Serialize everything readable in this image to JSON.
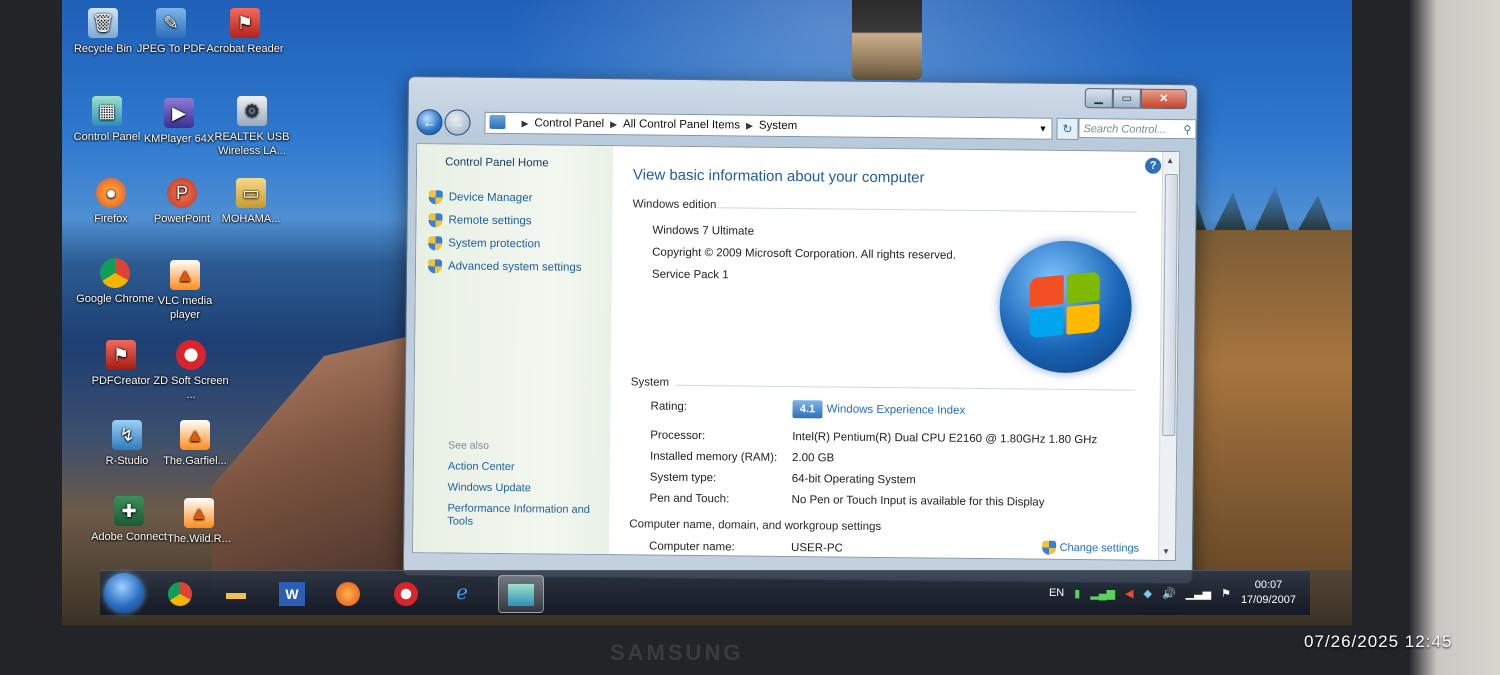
{
  "desktop": {
    "icons": [
      {
        "label": "Recycle Bin"
      },
      {
        "label": "JPEG To PDF"
      },
      {
        "label": "Acrobat Reader"
      },
      {
        "label": "Control Panel"
      },
      {
        "label": "KMPlayer 64X"
      },
      {
        "label": "REALTEK USB Wireless LA..."
      },
      {
        "label": "Firefox"
      },
      {
        "label": "PowerPoint"
      },
      {
        "label": "MOHAMA..."
      },
      {
        "label": "Google Chrome"
      },
      {
        "label": "VLC media player"
      },
      {
        "label": "PDFCreator"
      },
      {
        "label": "ZD Soft Screen ..."
      },
      {
        "label": "R-Studio"
      },
      {
        "label": "The.Garfiel..."
      },
      {
        "label": "Adobe Connect"
      },
      {
        "label": "The.Wild.R..."
      }
    ]
  },
  "window": {
    "address": {
      "crumbs": [
        "Control Panel",
        "All Control Panel Items",
        "System"
      ]
    },
    "search_placeholder": "Search Control...",
    "left_pane": {
      "home": "Control Panel Home",
      "links": [
        "Device Manager",
        "Remote settings",
        "System protection",
        "Advanced system settings"
      ],
      "see_also_title": "See also",
      "see_also": [
        "Action Center",
        "Windows Update",
        "Performance Information and Tools"
      ]
    },
    "main": {
      "heading": "View basic information about your computer",
      "edition_section": "Windows edition",
      "edition_lines": [
        "Windows 7 Ultimate",
        "Copyright © 2009 Microsoft Corporation.  All rights reserved.",
        "Service Pack 1"
      ],
      "system_section": "System",
      "rating_label": "Rating:",
      "rating_badge": "4.1",
      "rating_link": "Windows Experience Index",
      "rows": [
        {
          "label": "Processor:",
          "value": "Intel(R) Pentium(R) Dual  CPU  E2160  @ 1.80GHz  1.80 GHz"
        },
        {
          "label": "Installed memory (RAM):",
          "value": "2.00 GB"
        },
        {
          "label": "System type:",
          "value": "64-bit Operating System"
        },
        {
          "label": "Pen and Touch:",
          "value": "No Pen or Touch Input is available for this Display"
        }
      ],
      "computer_section": "Computer name, domain, and workgroup settings",
      "computer_name_label": "Computer name:",
      "computer_name_value": "USER-PC",
      "change_settings": "Change settings"
    }
  },
  "taskbar": {
    "lang": "EN",
    "time": "00:07",
    "date": "17/09/2007"
  },
  "monitor_brand": "SAMSUNG",
  "photo_timestamp": "07/26/2025  12:45",
  "colors": {
    "link": "#1e5f9e",
    "heading": "#1f5b9e",
    "close_button": "#c7432a"
  }
}
